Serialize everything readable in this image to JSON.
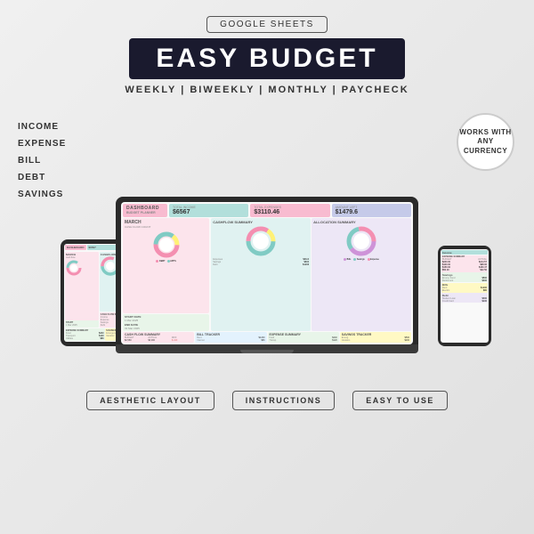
{
  "header": {
    "badge_label": "GOOGLE SHEETS",
    "main_title": "EASY BUDGET",
    "subtitle": "WEEKLY  |  BIWEEKLY  |  MONTHLY  |  PAYCHECK"
  },
  "sidebar": {
    "labels": [
      "INCOME",
      "EXPENSE",
      "BILL",
      "DEBT",
      "SAVINGS"
    ]
  },
  "currency_badge": {
    "line1": "WORKS WITH",
    "line2": "ANY",
    "line3": "CURRENCY"
  },
  "dashboard": {
    "title": "DASHBOARD",
    "subtitle": "BUDGET PLANNER",
    "month": "MARCH",
    "month_sub": "CASH FLOW COUNT",
    "total_income_label": "TOTAL INCOME",
    "total_income_value": "$6567",
    "total_expenses_label": "TOTAL EXPENSES",
    "total_expenses_value": "$3110.46",
    "amount_left_label": "AMOUNT LEFT",
    "amount_left_value": "$1479.6"
  },
  "footer": {
    "badge1": "AESTHETIC LAYOUT",
    "badge2": "INSTRUCTIONS",
    "badge3": "EASY TO USE"
  },
  "colors": {
    "bg": "#e5e5e5",
    "title_bg": "#1a1a2e",
    "pink": "#f8bbd0",
    "mint": "#b2dfdb",
    "blue": "#bbdefb",
    "purple": "#e1bee7",
    "green": "#c8e6c9",
    "yellow": "#fff9c4"
  }
}
